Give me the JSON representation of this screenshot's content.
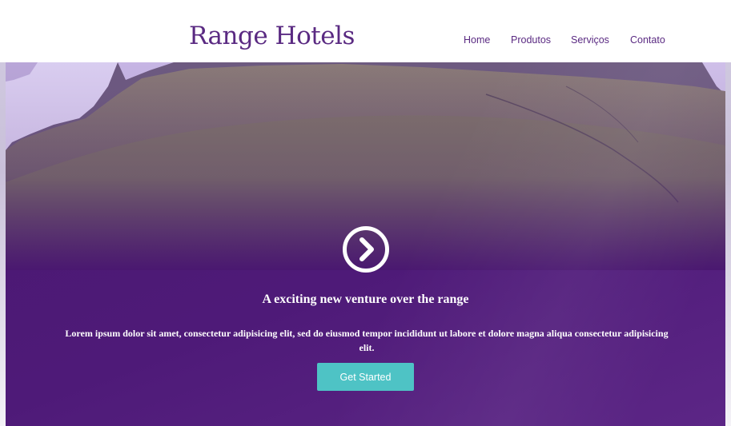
{
  "header": {
    "brand": "Range Hotels",
    "nav": [
      {
        "label": "Home"
      },
      {
        "label": "Produtos"
      },
      {
        "label": "Serviços"
      },
      {
        "label": "Contato"
      }
    ]
  },
  "hero": {
    "icon": "chevron-circle-right-icon",
    "title": "A exciting new venture over the range",
    "text": "Lorem ipsum dolor sit amet, consectetur adipisicing elit, sed do eiusmod tempor incididunt ut labore et dolore magna aliqua consectetur adipisicing elit.",
    "cta_label": "Get Started"
  },
  "colors": {
    "brand": "#5a2a82",
    "hero_overlay": "#4a1870",
    "cta": "#4ec3c5"
  }
}
